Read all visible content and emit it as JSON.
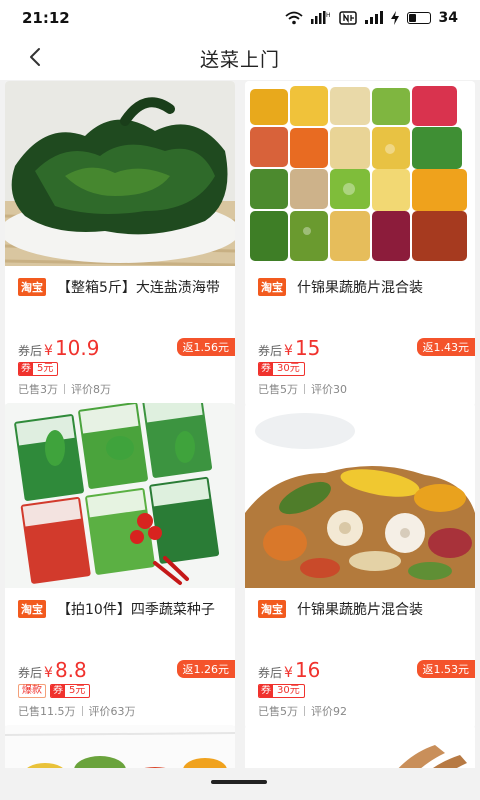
{
  "status": {
    "time": "21:12",
    "battery": "34",
    "battery_level": 0.34,
    "icons": [
      "wifi-icon",
      "hd-signal-icon",
      "nfc-icon",
      "cell-signal-icon",
      "charging-icon"
    ]
  },
  "header": {
    "title": "送菜上门"
  },
  "products": [
    {
      "platform": "淘宝",
      "title": "【整箱5斤】大连盐渍海带",
      "price_prefix": "券后",
      "currency": "¥",
      "price": "10.9",
      "rebate": "返1.56元",
      "hot": "",
      "coupon_tag": "券",
      "coupon_value": "5元",
      "sold": "已售3万",
      "reviews": "评价8万"
    },
    {
      "platform": "淘宝",
      "title": "什锦果蔬脆片混合装",
      "price_prefix": "券后",
      "currency": "¥",
      "price": "15",
      "rebate": "返1.43元",
      "hot": "",
      "coupon_tag": "券",
      "coupon_value": "30元",
      "sold": "已售5万",
      "reviews": "评价30"
    },
    {
      "platform": "淘宝",
      "title": "【拍10件】四季蔬菜种子",
      "price_prefix": "券后",
      "currency": "¥",
      "price": "8.8",
      "rebate": "返1.26元",
      "hot": "爆款",
      "coupon_tag": "券",
      "coupon_value": "5元",
      "sold": "已售11.5万",
      "reviews": "评价63万"
    },
    {
      "platform": "淘宝",
      "title": "什锦果蔬脆片混合装",
      "price_prefix": "券后",
      "currency": "¥",
      "price": "16",
      "rebate": "返1.53元",
      "hot": "",
      "coupon_tag": "券",
      "coupon_value": "30元",
      "sold": "已售5万",
      "reviews": "评价92"
    }
  ],
  "colors": {
    "accent": "#f0322d",
    "taobao": "#f25a1e",
    "rebate": "#f4532b",
    "background": "#f2f2f2"
  }
}
